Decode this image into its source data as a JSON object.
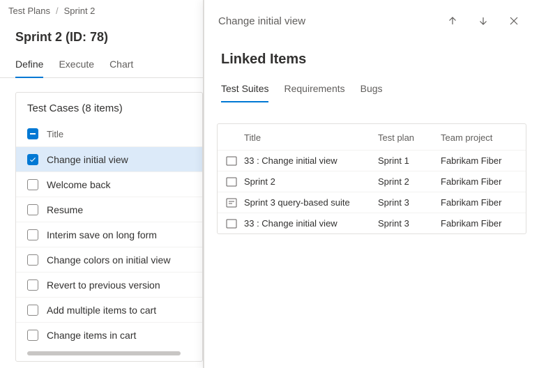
{
  "breadcrumb": {
    "root": "Test Plans",
    "current": "Sprint 2"
  },
  "page": {
    "title": "Sprint 2 (ID: 78)"
  },
  "tabs": [
    {
      "label": "Define",
      "active": true
    },
    {
      "label": "Execute",
      "active": false
    },
    {
      "label": "Chart",
      "active": false
    }
  ],
  "testCases": {
    "headerText": "Test Cases (8 items)",
    "columnLabel": "Title",
    "items": [
      {
        "title": "Change initial view",
        "checked": true
      },
      {
        "title": "Welcome back",
        "checked": false
      },
      {
        "title": "Resume",
        "checked": false
      },
      {
        "title": "Interim save on long form",
        "checked": false
      },
      {
        "title": "Change colors on initial view",
        "checked": false
      },
      {
        "title": "Revert to previous version",
        "checked": false
      },
      {
        "title": "Add multiple items to cart",
        "checked": false
      },
      {
        "title": "Change items in cart",
        "checked": false
      }
    ]
  },
  "panel": {
    "title": "Change initial view",
    "sectionTitle": "Linked Items",
    "tabs": [
      {
        "label": "Test Suites",
        "active": true
      },
      {
        "label": "Requirements",
        "active": false
      },
      {
        "label": "Bugs",
        "active": false
      }
    ],
    "table": {
      "columns": {
        "title": "Title",
        "plan": "Test plan",
        "project": "Team project"
      },
      "rows": [
        {
          "icon": "suite-static",
          "title": "33 : Change initial view",
          "plan": "Sprint 1",
          "project": "Fabrikam Fiber"
        },
        {
          "icon": "suite-static",
          "title": "Sprint 2",
          "plan": "Sprint 2",
          "project": "Fabrikam Fiber"
        },
        {
          "icon": "suite-query",
          "title": "Sprint 3 query-based suite",
          "plan": "Sprint 3",
          "project": "Fabrikam Fiber"
        },
        {
          "icon": "suite-static",
          "title": "33 : Change initial view",
          "plan": "Sprint 3",
          "project": "Fabrikam Fiber"
        }
      ]
    }
  }
}
